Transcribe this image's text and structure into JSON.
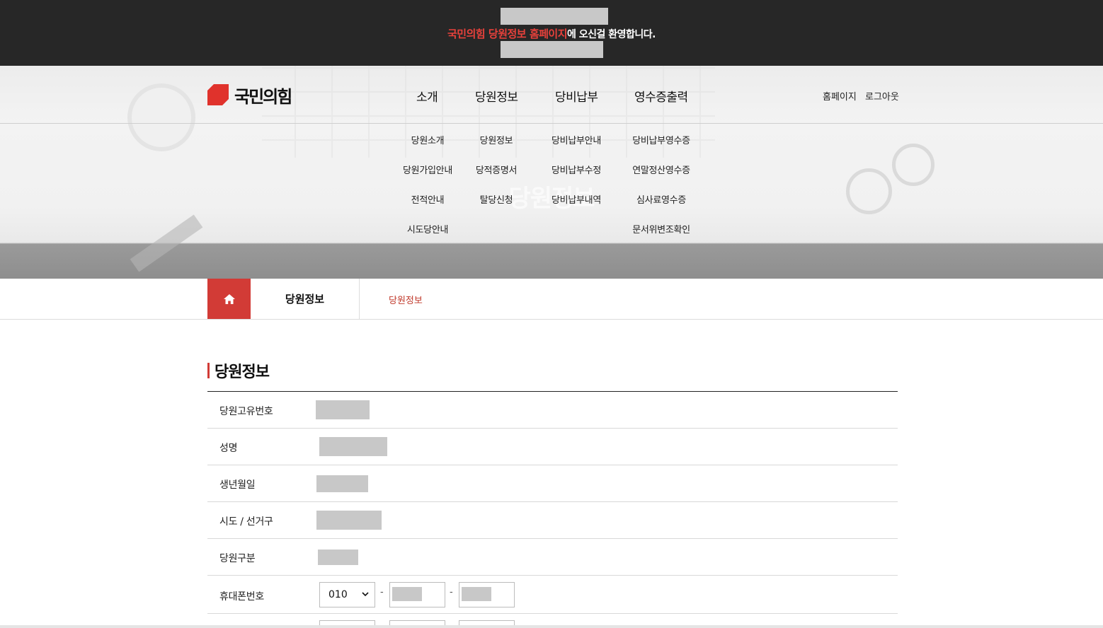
{
  "topbar": {
    "welcome_highlight": "국민의힘 당원정보 홈페이지",
    "welcome_rest": "에 오신걸 환영합니다."
  },
  "hero": {
    "ghost_title": "당원정보"
  },
  "header": {
    "logo_text": "국민의힘",
    "gnb": [
      "소개",
      "당원정보",
      "당비납부",
      "영수증출력"
    ],
    "util": [
      "홈페이지",
      "로그아웃"
    ]
  },
  "submenu": {
    "intro": [
      "당원소개",
      "당원가입안내",
      "전적안내",
      "시도당안내"
    ],
    "member": [
      "당원정보",
      "당적증명서",
      "탈당신청"
    ],
    "dues": [
      "당비납부안내",
      "당비납부수정",
      "당비납부내역"
    ],
    "receipt": [
      "당비납부영수증",
      "연말정산영수증",
      "심사료영수증",
      "문서위변조확인"
    ]
  },
  "location": {
    "current": "당원정보",
    "sub": "당원정보"
  },
  "page": {
    "title": "당원정보",
    "rows": [
      {
        "label": "당원고유번호"
      },
      {
        "label": "성명"
      },
      {
        "label": "생년월일"
      },
      {
        "label": "시도 / 선거구"
      },
      {
        "label": "당원구분"
      },
      {
        "label": "휴대폰번호"
      }
    ],
    "phone_prefix": "010",
    "phone_sep": "-"
  },
  "icons": {
    "home": "home-icon",
    "chevron": "chevron-down-icon"
  },
  "colors": {
    "accent": "#d23b36",
    "topbar": "#272727"
  }
}
